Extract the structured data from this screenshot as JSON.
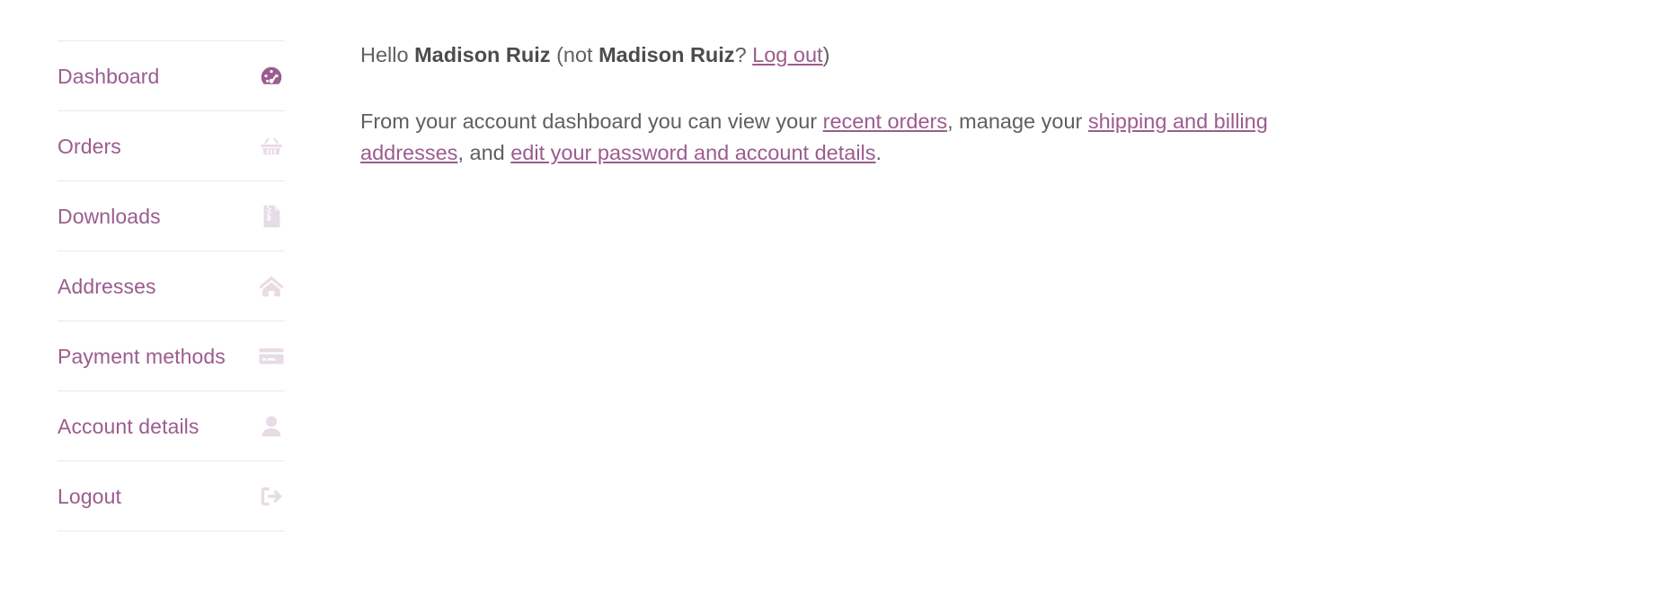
{
  "theme": {
    "accent": "#9B5C8F",
    "body_text": "#5F5F5F",
    "strong_text": "#4C4C4C",
    "icon_inactive": "#E7DBE6",
    "divider": "#EEE6EE",
    "background": "#FFFFFF"
  },
  "sidebar": {
    "items": [
      {
        "label": "Dashboard",
        "icon": "gauge-icon",
        "active": true
      },
      {
        "label": "Orders",
        "icon": "basket-icon",
        "active": false
      },
      {
        "label": "Downloads",
        "icon": "zip-file-icon",
        "active": false
      },
      {
        "label": "Addresses",
        "icon": "house-icon",
        "active": false
      },
      {
        "label": "Payment methods",
        "icon": "credit-card-icon",
        "active": false
      },
      {
        "label": "Account details",
        "icon": "user-icon",
        "active": false
      },
      {
        "label": "Logout",
        "icon": "sign-out-icon",
        "active": false
      }
    ]
  },
  "main": {
    "greeting": {
      "prefix": "Hello ",
      "user_name": "Madison Ruiz",
      "middle": " (not ",
      "user_name_repeat": "Madison Ruiz",
      "question_mark": "? ",
      "logout_link": "Log out",
      "suffix": ")"
    },
    "intro": {
      "part1": "From your account dashboard you can view your ",
      "link_recent_orders": "recent orders",
      "part2": ", manage your ",
      "link_addresses": "shipping and billing addresses",
      "part3": ", and ",
      "link_account": "edit your password and account details",
      "part4": "."
    }
  }
}
